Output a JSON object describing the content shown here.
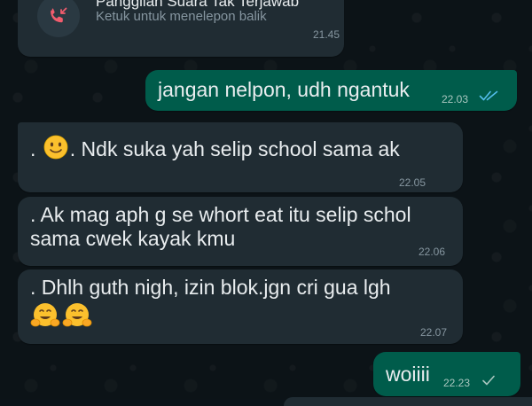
{
  "colors": {
    "incoming_bubble": "#202c33",
    "outgoing_bubble": "#005c4b",
    "missed_call_icon": "#f15c6d",
    "read_ticks": "#53bdeb",
    "sent_tick": "#a9c6bf"
  },
  "missed_call": {
    "icon": "missed-call-icon",
    "title": "Panggilan Suara Tak Terjawab",
    "subtitle": "Ketuk untuk menelepon balik",
    "time": "21.45"
  },
  "messages": [
    {
      "direction": "out",
      "text": "jangan nelpon, udh ngantuk",
      "time": "22.03",
      "status": "read"
    },
    {
      "direction": "in",
      "prefix": ".",
      "emoji": "slightly-smiling-face",
      "text": ". Ndk suka yah selip school sama ak",
      "time": "22.05"
    },
    {
      "direction": "in",
      "lines": [
        ". Ak mag aph g se whort eat itu selip schol",
        "sama cwek kayak kmu"
      ],
      "time": "22.06"
    },
    {
      "direction": "in",
      "text": ". Dhlh guth nigh, izin blok.jgn cri gua lgh",
      "emojis": [
        "hugging-face",
        "hugging-face"
      ],
      "time": "22.07"
    },
    {
      "direction": "out",
      "text": "woiiii",
      "time": "22.23",
      "status": "sent"
    }
  ]
}
